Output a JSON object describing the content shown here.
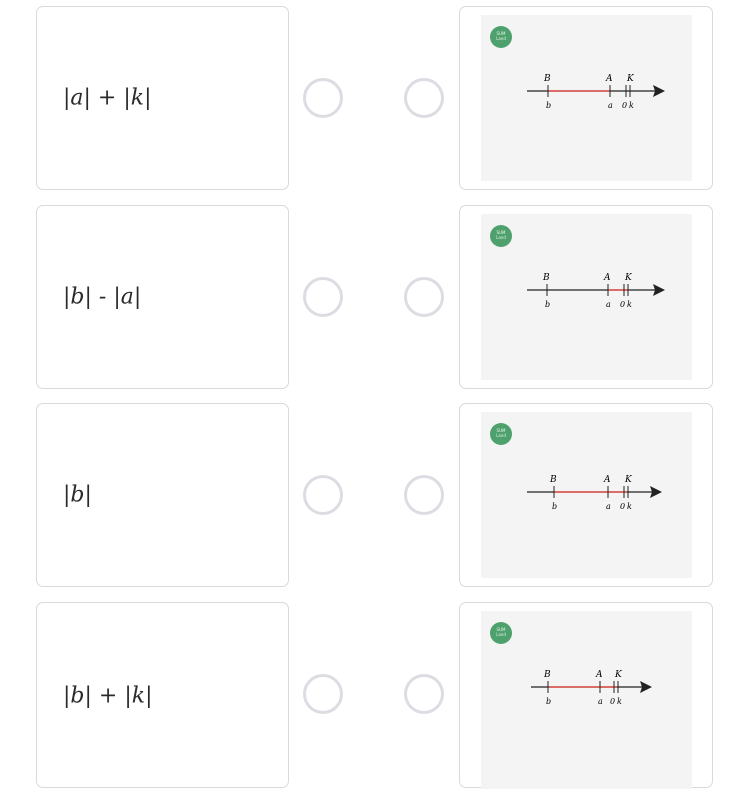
{
  "rows": [
    {
      "expression": "|a| + |k|",
      "diagram": {
        "badge_text": "SUM\nLand",
        "B": "B",
        "A": "A",
        "K": "K",
        "b": "b",
        "a": "a",
        "zero": "0",
        "k": "k"
      }
    },
    {
      "expression": "|b| - |a|",
      "diagram": {
        "badge_text": "SUM\nLand",
        "B": "B",
        "A": "A",
        "K": "K",
        "b": "b",
        "a": "a",
        "zero": "0",
        "k": "k"
      }
    },
    {
      "expression": "|b|",
      "diagram": {
        "badge_text": "SUM\nLand",
        "B": "B",
        "A": "A",
        "K": "K",
        "b": "b",
        "a": "a",
        "zero": "0",
        "k": "k"
      }
    },
    {
      "expression": "|b| + |k|",
      "diagram": {
        "badge_text": "SUM\nLand",
        "B": "B",
        "A": "A",
        "K": "K",
        "b": "b",
        "a": "a",
        "zero": "0",
        "k": "k"
      }
    }
  ],
  "colors": {
    "highlight": "#e0534a",
    "axis": "#222222",
    "badge": "#4ea16c"
  },
  "icons": [
    "radio-circle-icon",
    "number-line-diagram"
  ]
}
